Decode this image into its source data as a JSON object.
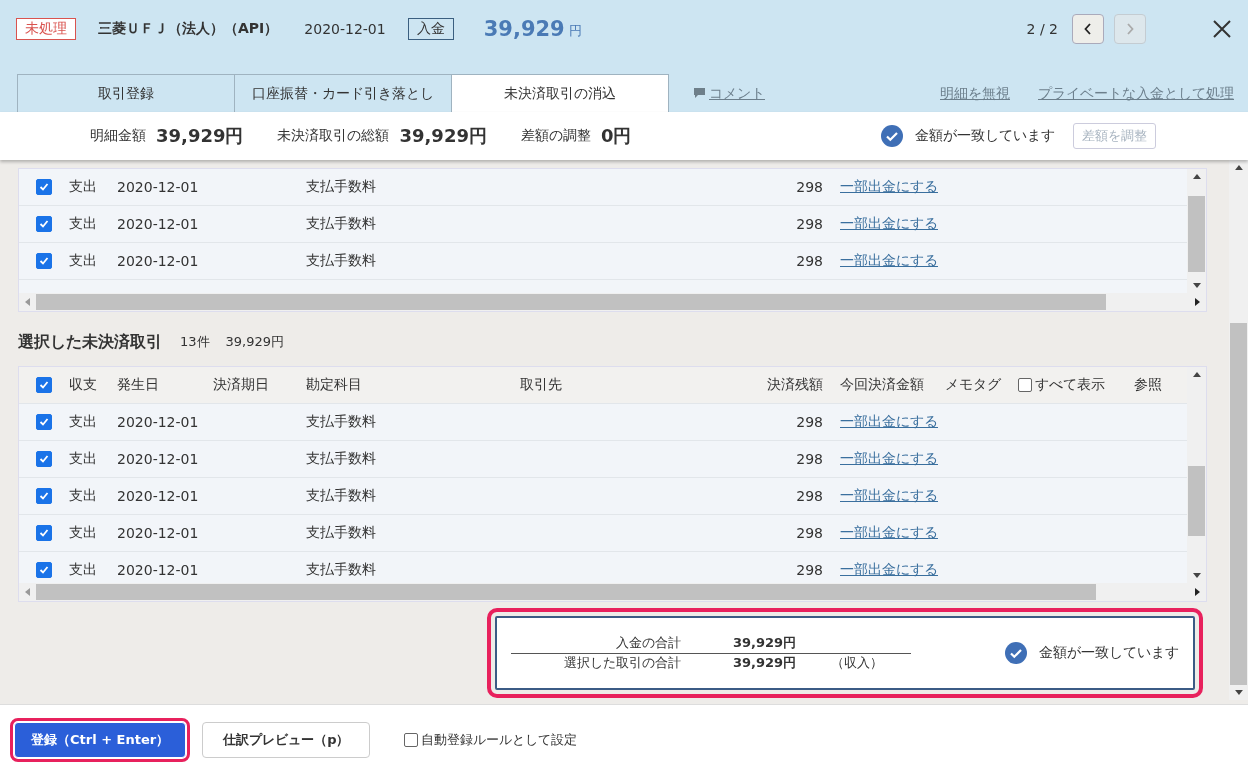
{
  "header": {
    "status": "未処理",
    "account": "三菱ＵＦＪ（法人）（API）",
    "date": "2020-12-01",
    "type": "入金",
    "amount": "39,929",
    "currency": "円",
    "pager": "2 / 2",
    "prev_disabled": false,
    "next_disabled": true
  },
  "tabs": [
    {
      "label": "取引登録",
      "selected": false
    },
    {
      "label": "口座振替・カード引き落とし",
      "selected": false
    },
    {
      "label": "未決済取引の消込",
      "selected": true
    }
  ],
  "tab_links": [
    {
      "kind": "comment",
      "label": "コメント"
    },
    {
      "kind": "plain",
      "label": "明細を無視"
    },
    {
      "kind": "plain",
      "label": "プライベートな入金として処理"
    }
  ],
  "summary": {
    "items": [
      {
        "label": "明細金額",
        "value": "39,929円"
      },
      {
        "label": "未決済取引の総額",
        "value": "39,929円"
      },
      {
        "label": "差額の調整",
        "value": "0円"
      }
    ],
    "match_text": "金額が一致しています",
    "adjust_button": "差額を調整",
    "adjust_disabled": true
  },
  "upper_table": {
    "rows": [
      {
        "checked": true,
        "type": "支出",
        "date": "2020-12-01",
        "account": "支払手数料",
        "balance": "298",
        "link": "一部出金にする"
      },
      {
        "checked": true,
        "type": "支出",
        "date": "2020-12-01",
        "account": "支払手数料",
        "balance": "298",
        "link": "一部出金にする"
      },
      {
        "checked": true,
        "type": "支出",
        "date": "2020-12-01",
        "account": "支払手数料",
        "balance": "298",
        "link": "一部出金にする"
      }
    ]
  },
  "selected_section": {
    "title": "選択した未決済取引",
    "count": "13件",
    "total": "39,929円"
  },
  "lower_table": {
    "all_checked": true,
    "columns": [
      "収支",
      "発生日",
      "決済期日",
      "勘定科目",
      "取引先",
      "決済残額",
      "今回決済金額",
      "メモタグ"
    ],
    "show_all": {
      "label": "すべて表示",
      "checked": false
    },
    "column_last": "参照",
    "rows": [
      {
        "checked": true,
        "type": "支出",
        "date": "2020-12-01",
        "account": "支払手数料",
        "balance": "298",
        "link": "一部出金にする"
      },
      {
        "checked": true,
        "type": "支出",
        "date": "2020-12-01",
        "account": "支払手数料",
        "balance": "298",
        "link": "一部出金にする"
      },
      {
        "checked": true,
        "type": "支出",
        "date": "2020-12-01",
        "account": "支払手数料",
        "balance": "298",
        "link": "一部出金にする"
      },
      {
        "checked": true,
        "type": "支出",
        "date": "2020-12-01",
        "account": "支払手数料",
        "balance": "298",
        "link": "一部出金にする"
      },
      {
        "checked": true,
        "type": "支出",
        "date": "2020-12-01",
        "account": "支払手数料",
        "balance": "298",
        "link": "一部出金にする"
      }
    ]
  },
  "totals": {
    "rows": [
      {
        "label": "入金の合計",
        "value": "39,929円"
      },
      {
        "label": "選択した取引の合計",
        "value": "39,929円",
        "note": "（収入）"
      }
    ],
    "match_text": "金額が一致しています"
  },
  "footer": {
    "register_button": "登録（Ctrl + Enter）",
    "preview_button": "仕訳プレビュー（p）",
    "auto_rule": {
      "label": "自動登録ルールとして設定",
      "checked": false
    }
  }
}
